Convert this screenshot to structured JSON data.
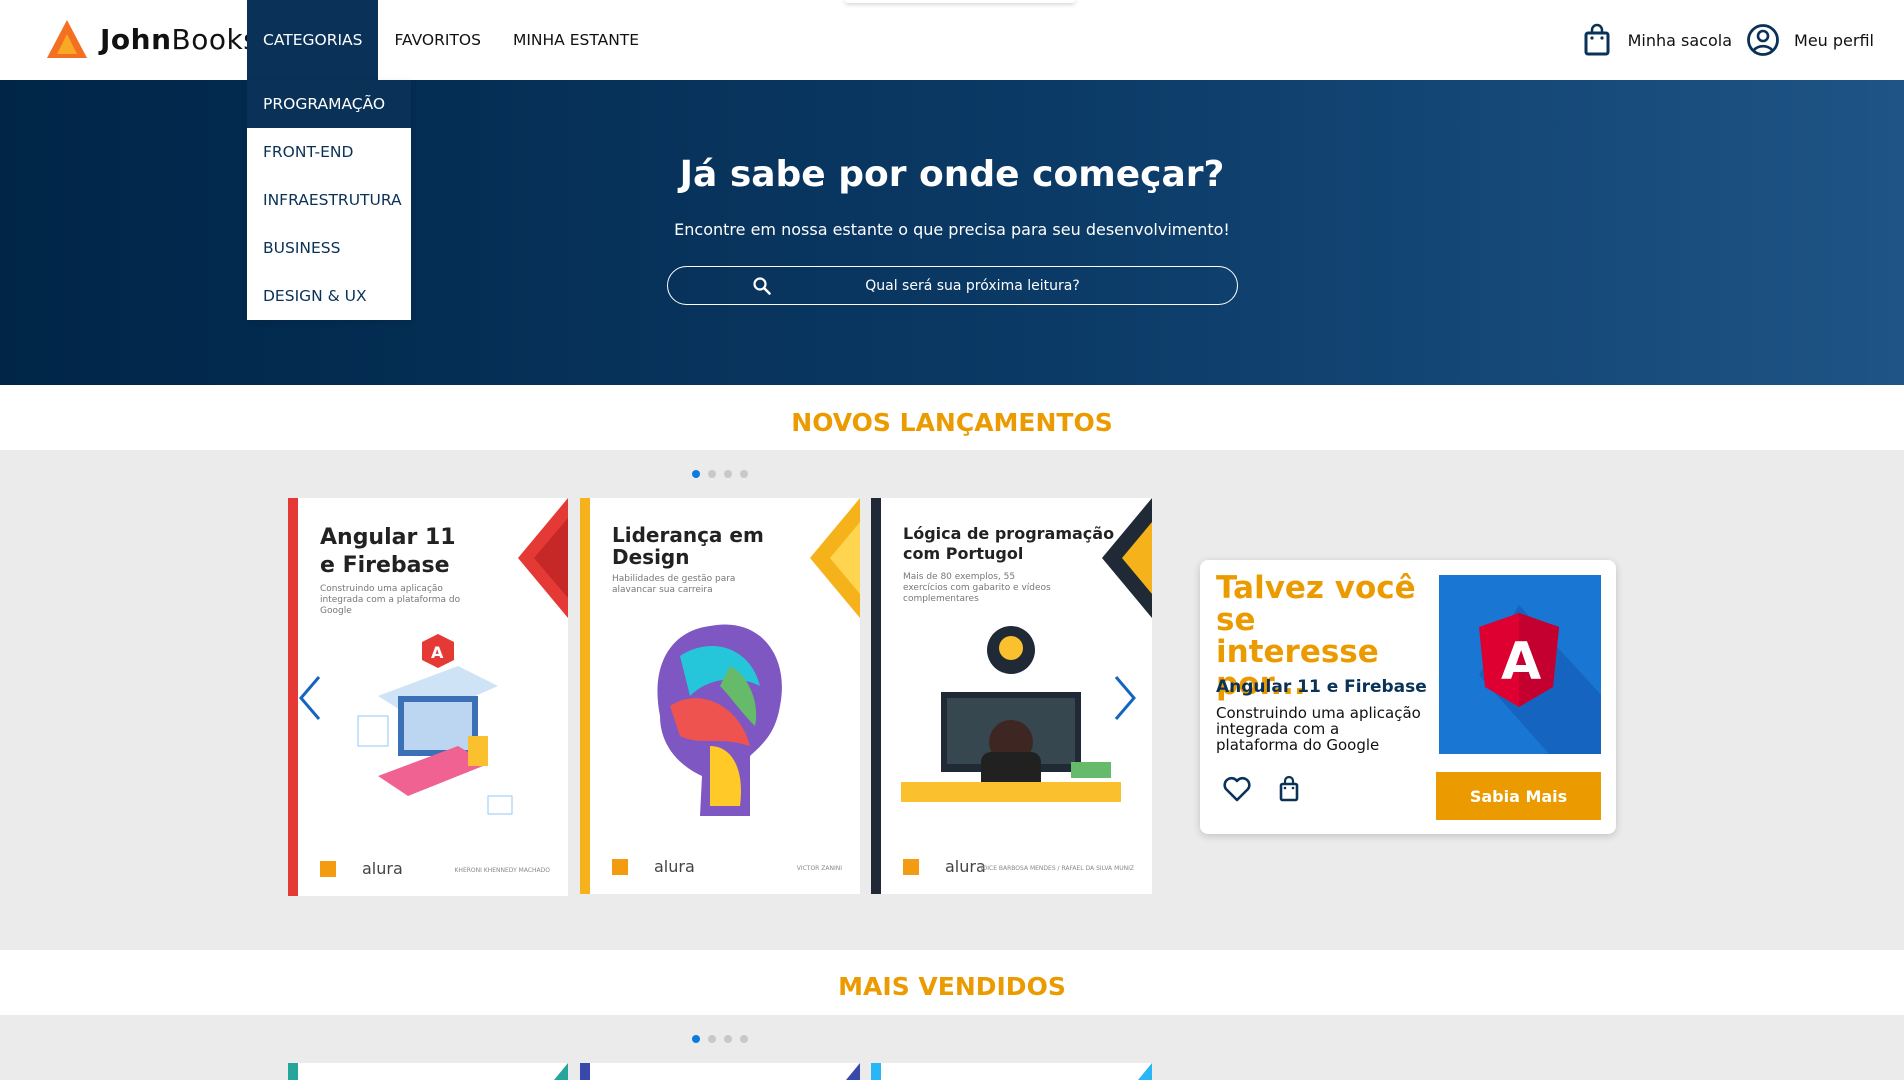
{
  "header": {
    "logo_text_a": "John",
    "logo_text_b": "Books",
    "nav": [
      {
        "label": "CATEGORIAS"
      },
      {
        "label": "FAVORITOS"
      },
      {
        "label": "MINHA ESTANTE"
      }
    ],
    "dropdown": [
      {
        "label": "PROGRAMAÇÃO"
      },
      {
        "label": "FRONT-END"
      },
      {
        "label": "INFRAESTRUTURA"
      },
      {
        "label": "BUSINESS"
      },
      {
        "label": "DESIGN & UX"
      }
    ],
    "bag_label": "Minha sacola",
    "profile_label": "Meu perfil"
  },
  "banner": {
    "title": "Já sabe por onde começar?",
    "subtitle": "Encontre em nossa estante o que precisa para seu desenvolvimento!",
    "search_placeholder": "Qual será sua próxima leitura?"
  },
  "sections": {
    "new_releases": "NOVOS LANÇAMENTOS",
    "best_sellers": "MAIS VENDIDOS"
  },
  "books": [
    {
      "title_line1": "Angular 11",
      "title_line2": "e Firebase",
      "subtitle": "Construindo uma aplicação integrada com a plataforma do Google",
      "brand": "alura",
      "author": "KHERONI KHENNEDY MACHADO",
      "accent": "#e53935"
    },
    {
      "title_line1": "Liderança em",
      "title_line2": "Design",
      "subtitle": "Habilidades de gestão para alavancar sua carreira",
      "brand": "alura",
      "author": "VICTOR ZANINI",
      "accent": "#f6b21b"
    },
    {
      "title_line1": "Lógica de programação",
      "title_line2": "com Portugol",
      "subtitle": "Mais de 80 exemplos, 55 exercícios com gabarito e vídeos complementares",
      "brand": "alura",
      "author": "JOICE BARBOSA MENDES / RAFAEL DA SILVA MUNIZ",
      "accent": "#1f2a36"
    }
  ],
  "suggestion": {
    "heading": "Talvez você se interesse por...",
    "book_title": "Angular 11 e Firebase",
    "description": "Construindo uma aplicação integrada com a plataforma do Google",
    "button": "Sabia Mais"
  },
  "colors": {
    "navy": "#0a3158",
    "orange": "#eb9b00",
    "dot_active": "#0b7be0",
    "carousel_bg": "#ebebeb"
  }
}
